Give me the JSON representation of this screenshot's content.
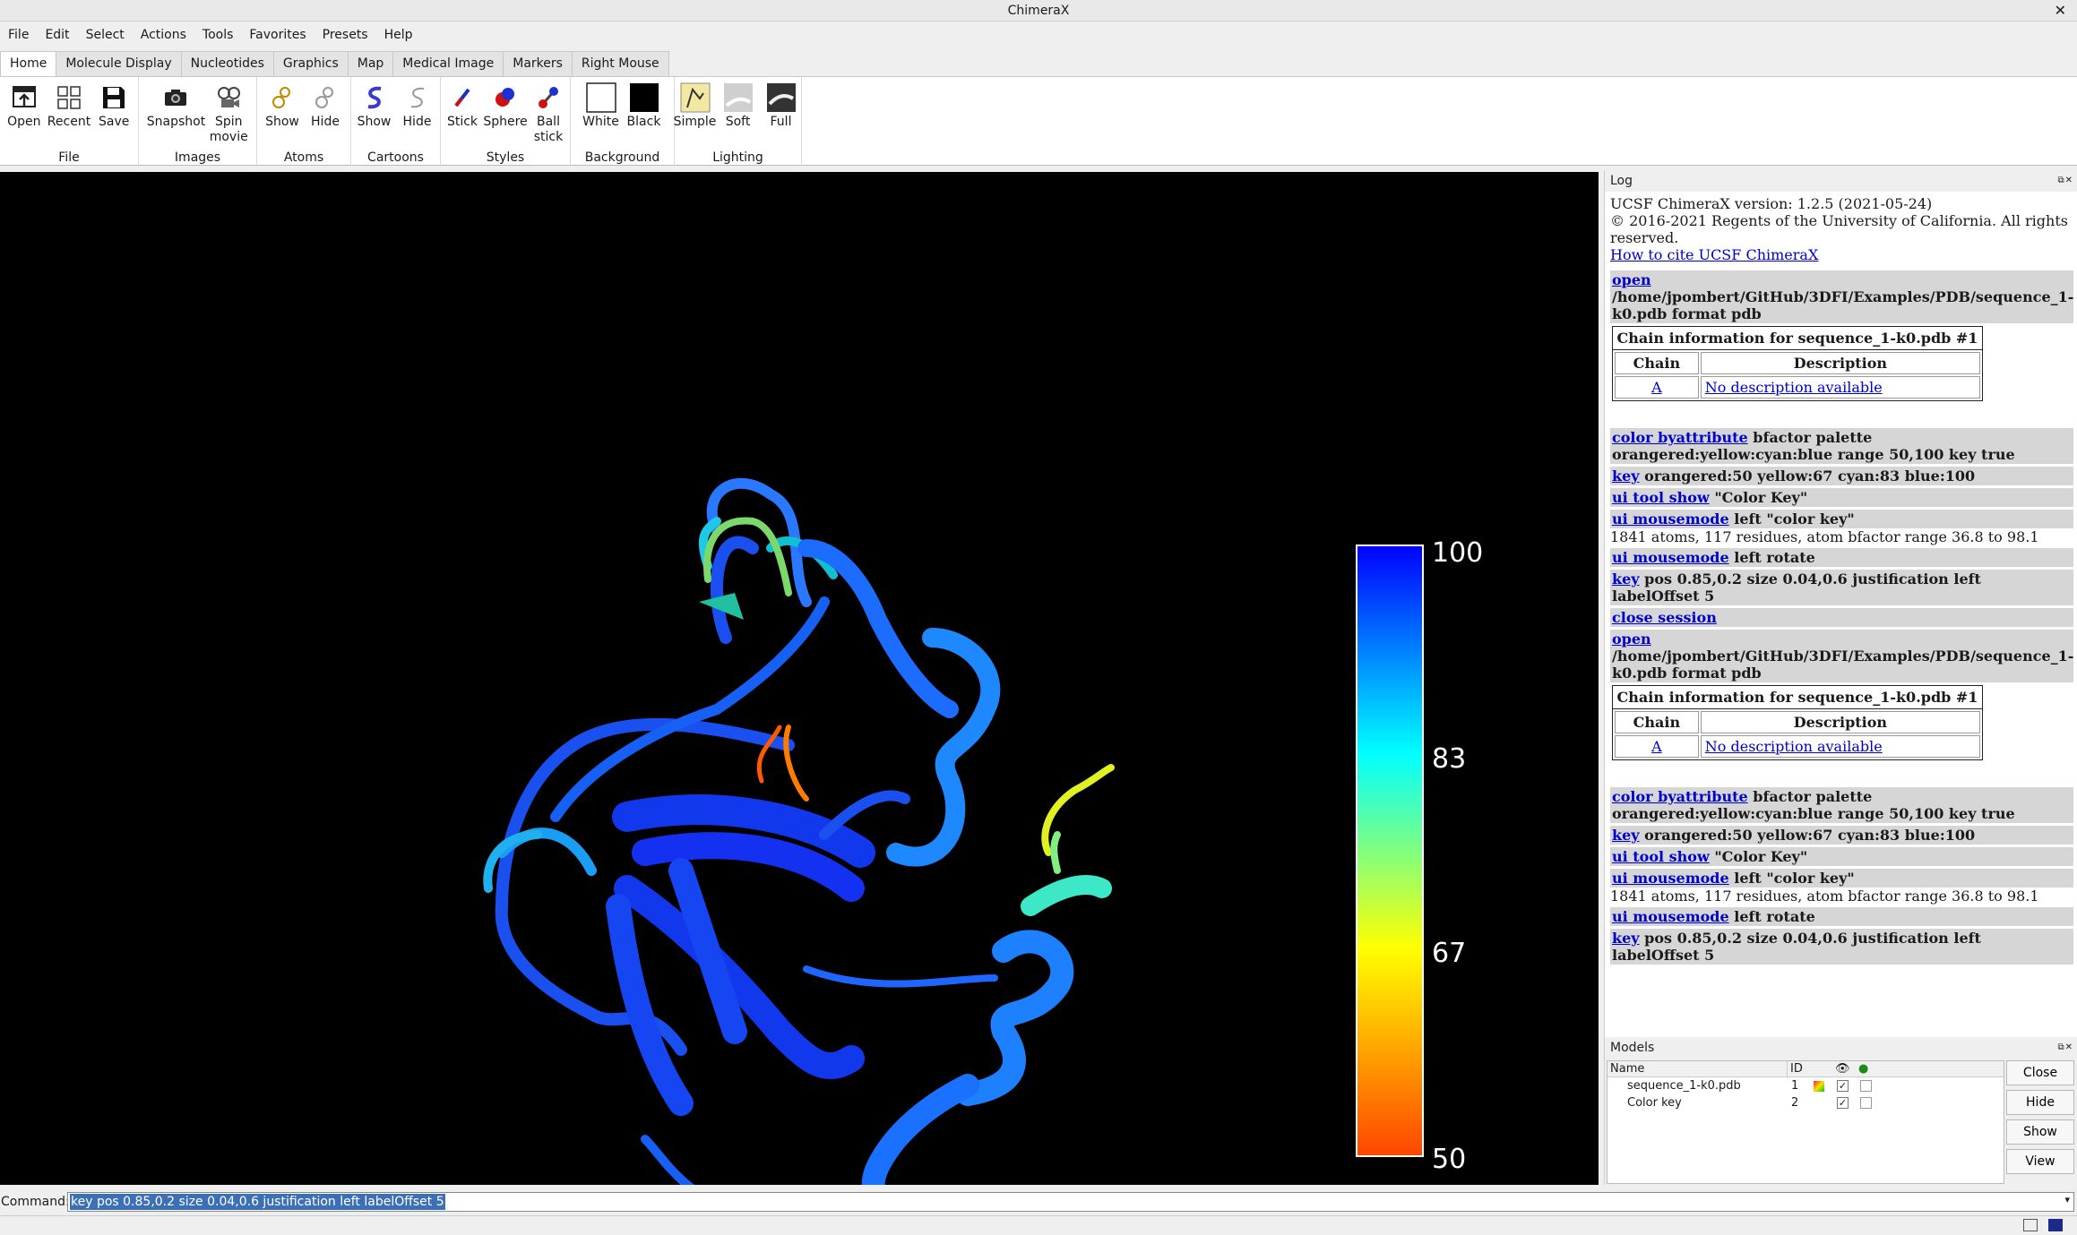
{
  "window": {
    "title": "ChimeraX",
    "close_glyph": "✕"
  },
  "menubar": [
    "File",
    "Edit",
    "Select",
    "Actions",
    "Tools",
    "Favorites",
    "Presets",
    "Help"
  ],
  "tabs": [
    "Home",
    "Molecule Display",
    "Nucleotides",
    "Graphics",
    "Map",
    "Medical Image",
    "Markers",
    "Right Mouse"
  ],
  "toolbar": {
    "groups": [
      {
        "label": "File",
        "buttons": [
          {
            "label": "Open",
            "icon": "open-icon"
          },
          {
            "label": "Recent",
            "icon": "recent-grid-icon"
          },
          {
            "label": "Save",
            "icon": "save-icon"
          }
        ]
      },
      {
        "label": "Images",
        "buttons": [
          {
            "label": "Snapshot",
            "icon": "camera-icon"
          },
          {
            "label": "Spin\nmovie",
            "icon": "film-reel-icon"
          }
        ]
      },
      {
        "label": "Atoms",
        "buttons": [
          {
            "label": "Show",
            "icon": "atoms-show-icon"
          },
          {
            "label": "Hide",
            "icon": "atoms-hide-icon"
          }
        ]
      },
      {
        "label": "Cartoons",
        "buttons": [
          {
            "label": "Show",
            "icon": "cartoon-show-icon"
          },
          {
            "label": "Hide",
            "icon": "cartoon-hide-icon"
          }
        ]
      },
      {
        "label": "Styles",
        "buttons": [
          {
            "label": "Stick",
            "icon": "stick-icon"
          },
          {
            "label": "Sphere",
            "icon": "sphere-icon"
          },
          {
            "label": "Ball\nstick",
            "icon": "ball-stick-icon"
          }
        ]
      },
      {
        "label": "Background",
        "buttons": [
          {
            "label": "White",
            "icon": "white-swatch-icon"
          },
          {
            "label": "Black",
            "icon": "black-swatch-icon"
          }
        ]
      },
      {
        "label": "Lighting",
        "buttons": [
          {
            "label": "Simple",
            "icon": "lighting-simple-icon"
          },
          {
            "label": "Soft",
            "icon": "lighting-soft-icon"
          },
          {
            "label": "Full",
            "icon": "lighting-full-icon"
          }
        ]
      }
    ]
  },
  "colorkey": {
    "labels": [
      "100",
      "83",
      "67",
      "50"
    ],
    "stops": [
      {
        "value": 100,
        "color": "#0000ff"
      },
      {
        "value": 83,
        "color": "#00ffff"
      },
      {
        "value": 67,
        "color": "#ffff00"
      },
      {
        "value": 50,
        "color": "#ff4500"
      }
    ]
  },
  "log": {
    "title": "Log",
    "version": "UCSF ChimeraX version: 1.2.5 (2021-05-24)",
    "copyright": "© 2016-2021 Regents of the University of California. All rights reserved.",
    "cite_link": "How to cite UCSF ChimeraX",
    "open_cmd": "open",
    "open_path": " /home/jpombert/GitHub/3DFI/Examples/PDB/sequence_1-k0.pdb format pdb",
    "table_caption": "Chain information for sequence_1-k0.pdb #1",
    "table_headers": [
      "Chain",
      "Description"
    ],
    "chain": "A",
    "description": "No description available",
    "c1_cmd": "color byattribute",
    "c1_rest": " bfactor palette orangered:yellow:cyan:blue range 50,100 key true",
    "c2_cmd": "key",
    "c2_rest": " orangered:50 yellow:67 cyan:83 blue:100",
    "c3_cmd": "ui tool show",
    "c3_rest": " \"Color Key\"",
    "c4_cmd": "ui mousemode",
    "c4_rest": " left \"color key\"",
    "atoms_info": "1841 atoms, 117 residues, atom bfactor range 36.8 to 98.1",
    "c5_cmd": "ui mousemode",
    "c5_rest": " left rotate",
    "c6_cmd": "key",
    "c6_rest": " pos 0.85,0.2 size 0.04,0.6 justification left labelOffset 5",
    "close_cmd": "close session"
  },
  "models": {
    "title": "Models",
    "headers": {
      "name": "Name",
      "id": "ID"
    },
    "rows": [
      {
        "name": "sequence_1-k0.pdb",
        "id": "1",
        "shown": "✓"
      },
      {
        "name": "Color key",
        "id": "2",
        "shown": "✓"
      }
    ],
    "buttons": [
      "Close",
      "Hide",
      "Show",
      "View"
    ]
  },
  "command": {
    "label": "Command:",
    "value": "key pos 0.85,0.2 size 0.04,0.6 justification left labelOffset 5"
  }
}
